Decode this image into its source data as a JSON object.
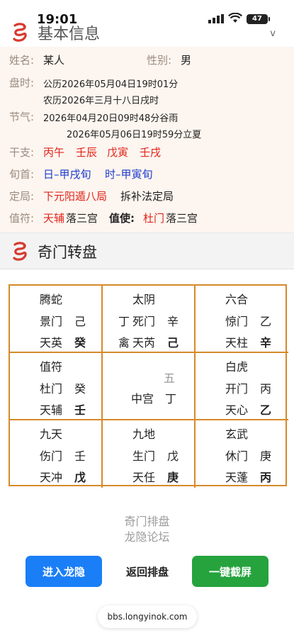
{
  "status_bar": {
    "time": "19:01",
    "battery": "47"
  },
  "basic": {
    "title": "基本信息",
    "collapse": "v",
    "name_label": "姓名:",
    "name_value": "某人",
    "gender_label": "性别:",
    "gender_value": "男",
    "time_label": "盘时:",
    "solar": "公历2026年05月04日19时01分",
    "lunar": "农历2026年三月十八日戌时",
    "term_label": "节气:",
    "term1": "2026年04月20日09时48分谷雨",
    "term2": "2026年05月06日19时59分立夏",
    "ganzhi_label": "干支:",
    "ganzhi": [
      "丙午",
      "壬辰",
      "戊寅",
      "壬戌"
    ],
    "xunshou_label": "旬首:",
    "xunshou": [
      "日–甲戌旬",
      "时–甲寅旬"
    ],
    "ju_label": "定局:",
    "ju_value": "下元阳遁八局",
    "ju_method": "拆补法定局",
    "zhifu_label": "值符:",
    "zhifu_star": "天辅",
    "zhifu_palace": "落三宫",
    "zhishi_label": "值使:",
    "zhishi_gate": "杜门",
    "zhishi_palace": "落三宫"
  },
  "pan": {
    "title": "奇门转盘",
    "cells": [
      {
        "god": "腾蛇",
        "gate": "景门",
        "stem_top": "己",
        "star": "天英",
        "stem_bottom": "癸"
      },
      {
        "god": "太阴",
        "pre_top": "丁",
        "gate": "死门",
        "stem_top": "辛",
        "pre_bottom": "禽",
        "star": "天芮",
        "stem_bottom": "己"
      },
      {
        "god": "六合",
        "gate": "惊门",
        "stem_top": "乙",
        "star": "天柱",
        "stem_bottom": "辛"
      },
      {
        "god": "值符",
        "gate": "杜门",
        "stem_top": "癸",
        "star": "天辅",
        "stem_bottom": "壬"
      },
      {
        "number": "五",
        "center": "中宫",
        "stem": "丁"
      },
      {
        "god": "白虎",
        "gate": "开门",
        "stem_top": "丙",
        "star": "天心",
        "stem_bottom": "乙"
      },
      {
        "god": "九天",
        "gate": "伤门",
        "stem_top": "壬",
        "star": "天冲",
        "stem_bottom": "戊"
      },
      {
        "god": "九地",
        "gate": "生门",
        "stem_top": "戊",
        "star": "天任",
        "stem_bottom": "庚"
      },
      {
        "god": "玄武",
        "gate": "休门",
        "stem_top": "庚",
        "star": "天蓬",
        "stem_bottom": "丙"
      }
    ]
  },
  "footer": {
    "line1": "奇门排盘",
    "line2": "龙隐论坛",
    "btn_enter": "进入龙隐",
    "btn_back": "返回排盘",
    "btn_screenshot": "一键截屏",
    "url": "bbs.longyinok.com"
  },
  "colors": {
    "accent_red": "#e1251b",
    "accent_blue": "#1f3ccf",
    "grid_border": "#d58a2a",
    "btn_blue": "#1a7ef7",
    "btn_green": "#26a33d"
  },
  "icons": {
    "logo": "dragon-logo-icon",
    "signal": "signal-icon",
    "wifi": "wifi-icon",
    "battery": "battery-icon"
  }
}
